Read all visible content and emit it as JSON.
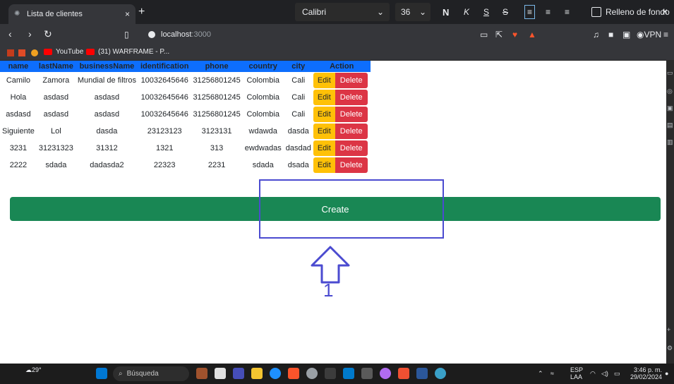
{
  "browser": {
    "tab_title": "Lista de clientes",
    "tab_close": "×",
    "new_tab": "+",
    "url_host": "localhost",
    "url_port": ":3000",
    "window_close": "×"
  },
  "format_toolbar": {
    "font_name": "Calibri",
    "font_size": "36",
    "bold": "N",
    "italic": "K",
    "underline": "S",
    "strike": "S",
    "fill_label": "Relleno de fondo"
  },
  "bookmarks": [
    {
      "label": "YouTube"
    },
    {
      "label": "(31) WARFRAME - P..."
    }
  ],
  "table": {
    "headers": [
      "name",
      "lastName",
      "businessName",
      "identification",
      "phone",
      "country",
      "city",
      "Action"
    ],
    "rows": [
      [
        "Camilo",
        "Zamora",
        "Mundial de filtros",
        "10032645646",
        "31256801245",
        "Colombia",
        "Cali"
      ],
      [
        "Hola",
        "asdasd",
        "asdasd",
        "10032645646",
        "31256801245",
        "Colombia",
        "Cali"
      ],
      [
        "asdasd",
        "asdasd",
        "asdasd",
        "10032645646",
        "31256801245",
        "Colombia",
        "Cali"
      ],
      [
        "Siguiente",
        "Lol",
        "dasda",
        "23123123",
        "3123131",
        "wdawda",
        "dasda"
      ],
      [
        "3231",
        "31231323",
        "31312",
        "1321",
        "313",
        "ewdwadas",
        "dasdad"
      ],
      [
        "2222",
        "sdada",
        "dadasda2",
        "22323",
        "2231",
        "sdada",
        "dsada"
      ]
    ],
    "edit_label": "Edit",
    "delete_label": "Delete"
  },
  "create_label": "Create",
  "annotation": {
    "number": "1",
    "color": "#4b4bd0"
  },
  "taskbar": {
    "weather": "29°",
    "search_placeholder": "Búsqueda",
    "lang_1": "ESP",
    "lang_2": "LAA",
    "time": "3:46 p. m.",
    "date": "29/02/2024"
  },
  "colors": {
    "header_bg": "#0d6efd",
    "edit_bg": "#ffc107",
    "delete_bg": "#dc3545",
    "create_bg": "#198754"
  }
}
